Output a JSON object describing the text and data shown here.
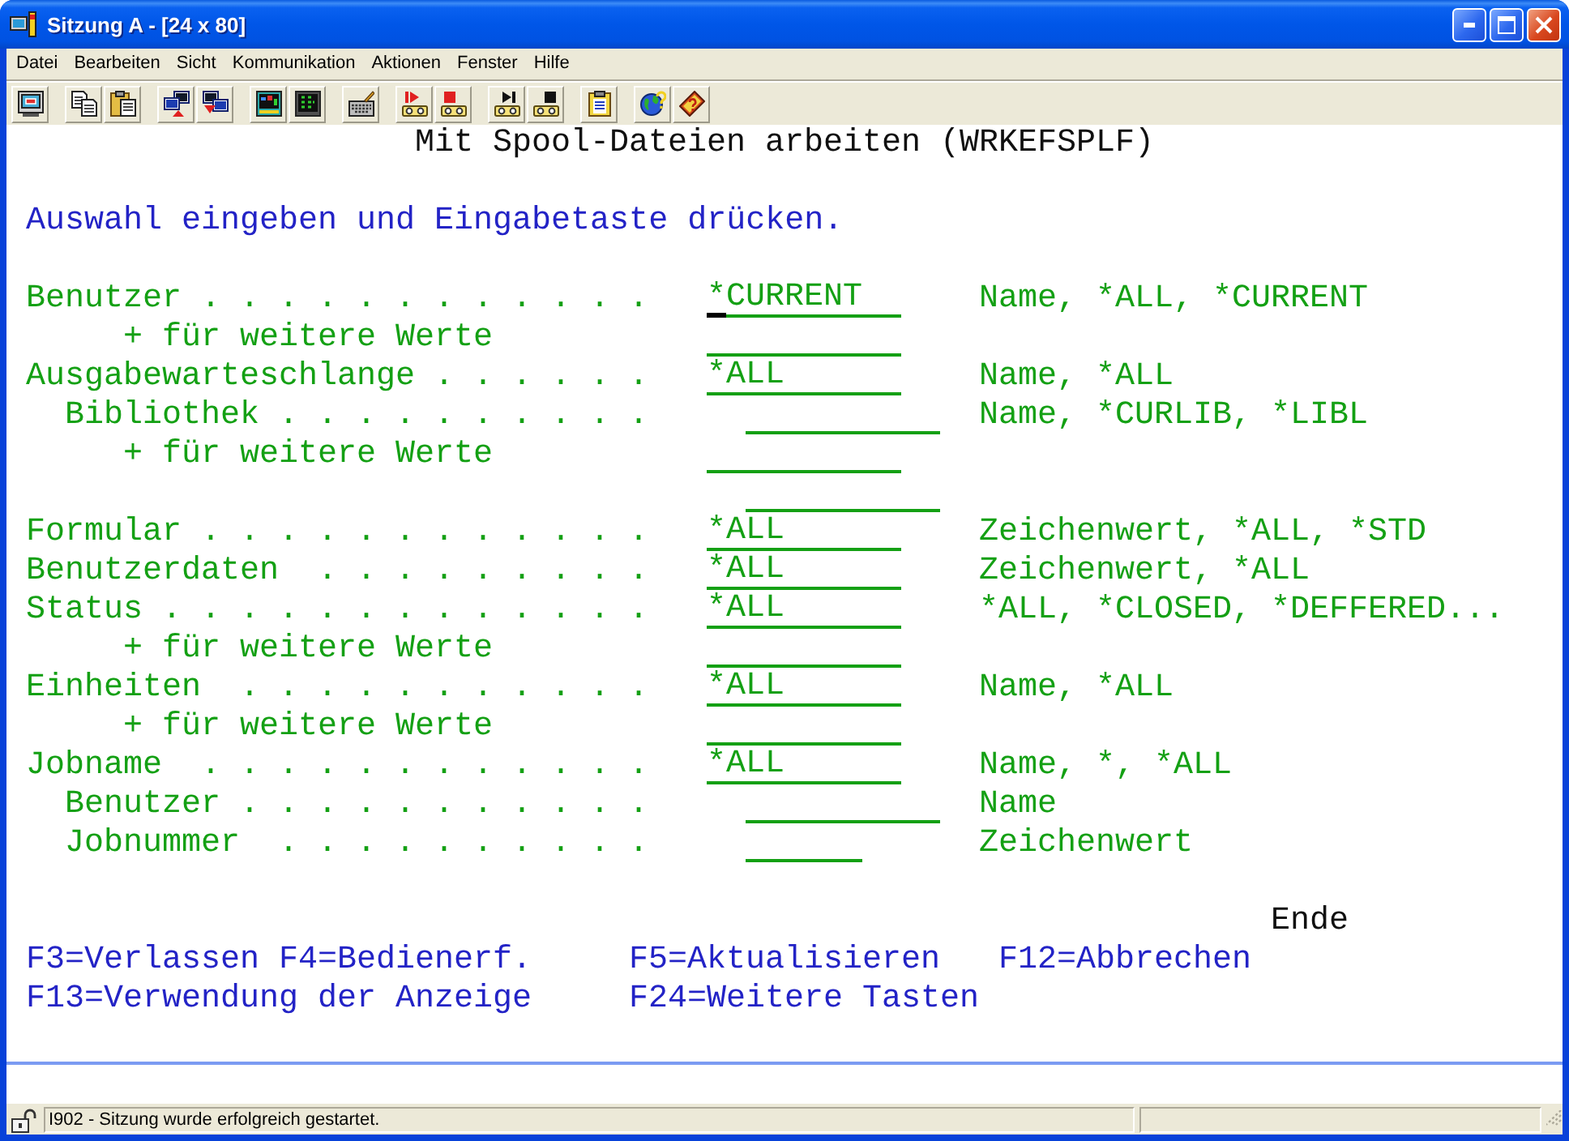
{
  "window": {
    "title": "Sitzung A - [24 x 80]"
  },
  "menu": [
    "Datei",
    "Bearbeiten",
    "Sicht",
    "Kommunikation",
    "Aktionen",
    "Fenster",
    "Hilfe"
  ],
  "screen": {
    "title": "Mit Spool-Dateien arbeiten (WRKEFSPLF)",
    "instruction": "Auswahl eingeben und Eingabetaste drücken.",
    "parameters": [
      {
        "kind": "param",
        "label": "Benutzer . . . . . . . . . . . .",
        "field": {
          "kind": "name",
          "value": "*CURRENT",
          "cursor": true
        },
        "hint": "Name, *ALL, *CURRENT"
      },
      {
        "kind": "more",
        "label": "+ für weitere Werte",
        "field": {
          "kind": "name",
          "cursor": false
        }
      },
      {
        "kind": "param",
        "label": "Ausgabewarteschlange . . . . . .",
        "field": {
          "kind": "name",
          "value": "*ALL",
          "cursor": false
        },
        "hint": "Name, *ALL",
        "children": [
          {
            "kind": "param",
            "label": "Bibliothek . . . . . . . . . .",
            "field": {
              "kind": "name",
              "cursor": false
            },
            "hint": "Name, *CURLIB, *LIBL"
          }
        ]
      },
      {
        "kind": "more",
        "label": "+ für weitere Werte",
        "field": {
          "kind": "name",
          "cursor": false
        },
        "children": [
          {
            "kind": "field",
            "field": {
              "kind": "name",
              "cursor": false
            }
          }
        ]
      },
      {
        "kind": "param",
        "label": "Formular . . . . . . . . . . . .",
        "field": {
          "kind": "name",
          "value": "*ALL",
          "cursor": false
        },
        "hint": "Zeichenwert, *ALL, *STD"
      },
      {
        "kind": "param",
        "label": "Benutzerdaten  . . . . . . . . .",
        "field": {
          "kind": "name",
          "value": "*ALL",
          "cursor": false
        },
        "hint": "Zeichenwert, *ALL"
      },
      {
        "kind": "param",
        "label": "Status . . . . . . . . . . . . .",
        "field": {
          "kind": "name",
          "value": "*ALL",
          "cursor": false
        },
        "hint": "*ALL, *CLOSED, *DEFFERED..."
      },
      {
        "kind": "more",
        "label": "+ für weitere Werte",
        "field": {
          "kind": "name",
          "cursor": false
        }
      },
      {
        "kind": "param",
        "label": "Einheiten  . . . . . . . . . . .",
        "field": {
          "kind": "name",
          "value": "*ALL",
          "cursor": false
        },
        "hint": "Name, *ALL"
      },
      {
        "kind": "more",
        "label": "+ für weitere Werte",
        "field": {
          "kind": "name",
          "cursor": false
        }
      },
      {
        "kind": "param",
        "label": "Jobname  . . . . . . . . . . . .",
        "field": {
          "kind": "name",
          "value": "*ALL",
          "cursor": false
        },
        "hint": "Name, *, *ALL",
        "children": [
          {
            "kind": "param",
            "label": "Benutzer . . . . . . . . . . .",
            "field": {
              "kind": "name",
              "cursor": false
            },
            "hint": "Name"
          },
          {
            "kind": "param",
            "label": "Jobnummer  . . . . . . . . . .",
            "field": {
              "kind": "number",
              "cursor": false
            },
            "hint": "Zeichenwert"
          }
        ]
      }
    ],
    "more_indicator": "Ende",
    "function_keys": [
      [
        "F3=Verlassen",
        "F4=Bedienerf.",
        "F5=Aktualisieren",
        "F12=Abbrechen"
      ],
      [
        "F13=Verwendung der Anzeige",
        "F24=Weitere Tasten"
      ]
    ]
  },
  "status_bar": {
    "message": "I902 - Sitzung wurde erfolgreich gestartet."
  }
}
